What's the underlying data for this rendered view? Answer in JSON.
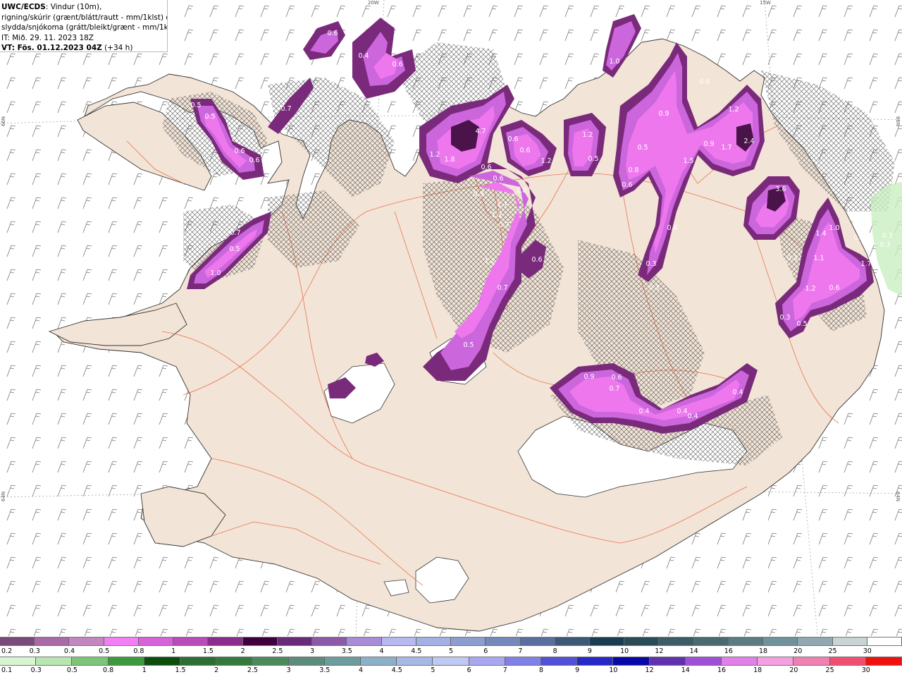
{
  "info": {
    "title": "UWC/ECDS",
    "line1_rest": ": Vindur (10m),",
    "line2": "rigning/skúrir (grænt/blátt/rautt - mm/1klst) og",
    "line3": "slydda/snjókoma (grátt/bleikt/grænt - mm/1klst)",
    "it": "IT: Mið. 29. 11. 2023 18Z",
    "vt_label": "VT:",
    "vt_value": " Fös. 01.12.2023 04Z",
    "lead": " (+34 h)"
  },
  "graticule": {
    "top": [
      "20W",
      "15W"
    ],
    "left": [
      "66N",
      "64N"
    ],
    "right": [
      "66N",
      "64N"
    ]
  },
  "colors": {
    "land": "#f2e4d6",
    "coast": "#333333",
    "roads": "#e8643a",
    "snow_light": "#cc66dd",
    "snow_mid": "#ee66ee",
    "snow_dark": "#7a2a7a",
    "snow_darkest": "#4a144a",
    "rain_light": "#c9efc1"
  },
  "precip_labels": [
    "0.6",
    "0.4",
    "0.6",
    "0.5",
    "0.6",
    "0.5",
    "0.5",
    "0.6",
    "0.6",
    "0.7",
    "1.0",
    "4.7",
    "1.2",
    "1.8",
    "0.6",
    "0.6",
    "0.6",
    "0.6",
    "1.2",
    "1.2",
    "0.5",
    "0.9",
    "0.8",
    "0.6",
    "0.7",
    "1.8",
    "1.7",
    "1.2",
    "1.2",
    "0.6",
    "0.7",
    "0.5",
    "0.3",
    "0.3",
    "0.7",
    "1.0",
    "0.5",
    "0.9",
    "1.5",
    "0.9",
    "1.7",
    "2.4",
    "1.2",
    "0.5",
    "0.6",
    "0.3",
    "3.6",
    "1.4",
    "1.0",
    "0.5",
    "0.3",
    "0.3",
    "1.1",
    "1.2",
    "0.6",
    "1.7",
    "0.3",
    "0.5",
    "0.9",
    "0.6",
    "0.7",
    "0.4",
    "0.4",
    "0.4",
    "0.4"
  ],
  "legend_snow": {
    "labels": [
      "0.2",
      "0.3",
      "0.4",
      "0.5",
      "0.8",
      "1",
      "1.5",
      "2",
      "2.5",
      "3",
      "3.5",
      "4",
      "4.5",
      "5",
      "6",
      "7",
      "8",
      "9",
      "10",
      "12",
      "14",
      "16",
      "18",
      "20",
      "25",
      "30"
    ],
    "colors": [
      "#7a4a78",
      "#a96aa7",
      "#c287c0",
      "#f47ff4",
      "#d862d8",
      "#b84cb8",
      "#8e2b8e",
      "#3d003d",
      "#6a2a7a",
      "#8c5aa8",
      "#a88cd8",
      "#b8b8f0",
      "#a4b0e4",
      "#8c9ed0",
      "#7488bc",
      "#5a6fa0",
      "#3e5878",
      "#1a3e50",
      "#2a4c58",
      "#3c5c66",
      "#4a6a72",
      "#5c7c84",
      "#70929a",
      "#90a8ae",
      "#c8d4d6",
      "#ffffff"
    ]
  },
  "legend_rain": {
    "labels": [
      "0.1",
      "0.3",
      "0.5",
      "0.8",
      "1",
      "1.5",
      "2",
      "2.5",
      "3",
      "3.5",
      "4",
      "4.5",
      "5",
      "6",
      "7",
      "8",
      "9",
      "10",
      "12",
      "14",
      "16",
      "18",
      "20",
      "25",
      "30"
    ],
    "colors": [
      "#d8f5d2",
      "#b8e6b0",
      "#7cc478",
      "#3c9a3c",
      "#0c4e0c",
      "#2c6e34",
      "#347a3c",
      "#4c8a5c",
      "#5c8c7c",
      "#6c9c9c",
      "#8cb0c8",
      "#a8b8e4",
      "#c0c8f4",
      "#a8a8f0",
      "#8080e8",
      "#5050d8",
      "#2828c8",
      "#0808a8",
      "#6030b0",
      "#a050d8",
      "#e080e8",
      "#f4a0e0",
      "#f080b0",
      "#f05070",
      "#f01010"
    ]
  }
}
